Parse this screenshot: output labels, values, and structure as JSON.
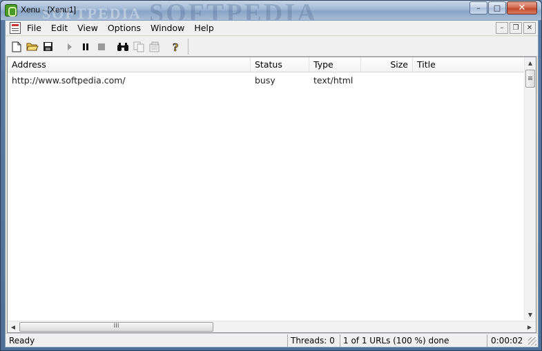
{
  "window": {
    "title": "Xenu - [Xenu1]",
    "watermark": "SOFTPEDIA",
    "watermark_small": "SOFTPEDIA",
    "caption_buttons": {
      "minimize": "–",
      "maximize": "□",
      "close": "✕"
    }
  },
  "menubar": {
    "items": [
      "File",
      "Edit",
      "View",
      "Options",
      "Window",
      "Help"
    ],
    "mdi_buttons": {
      "minimize": "–",
      "restore": "❐",
      "close": "✕"
    }
  },
  "toolbar": {
    "buttons": [
      "new-icon",
      "open-folder-icon",
      "save-icon",
      "play-icon",
      "pause-icon",
      "stop-icon",
      "binoculars-icon",
      "copy-icon",
      "properties-icon",
      "help-icon"
    ]
  },
  "list": {
    "columns": [
      "Address",
      "Status",
      "Type",
      "Size",
      "Title"
    ],
    "rows": [
      {
        "address": "http://www.softpedia.com/",
        "status": "busy",
        "type": "text/html",
        "size": "",
        "title": ""
      }
    ]
  },
  "scroll": {
    "hthumb_grip": "III"
  },
  "statusbar": {
    "status": "Ready",
    "threads": "Threads: 0",
    "progress": "1 of 1 URLs (100 %) done",
    "time": "0:00:02"
  },
  "colors": {
    "title_gradient": "#9fb7d4",
    "close_button": "#c04a2c",
    "workspace": "#f0f0f0"
  }
}
